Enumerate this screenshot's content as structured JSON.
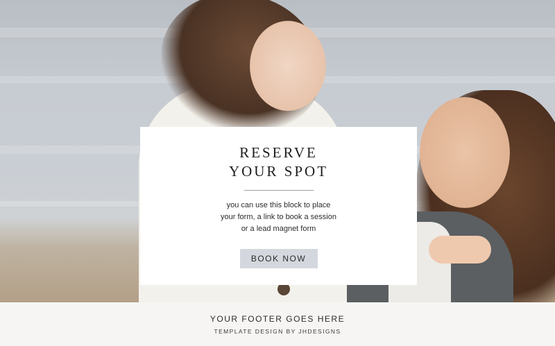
{
  "hero": {
    "image_description_icon": "photo-mother-daughter-beach"
  },
  "card": {
    "title_line1": "RESERVE",
    "title_line2": "YOUR SPOT",
    "body_line1": "you can use this block to place",
    "body_line2": "your form, a link to book a session",
    "body_line3": "or a lead magnet form",
    "button_label": "BOOK NOW"
  },
  "footer": {
    "title": "YOUR FOOTER GOES HERE",
    "credit": "TEMPLATE DESIGN BY JHDESIGNS"
  },
  "colors": {
    "button_bg": "#d4d8de",
    "card_bg": "#ffffff",
    "footer_bg": "#f6f5f3"
  }
}
